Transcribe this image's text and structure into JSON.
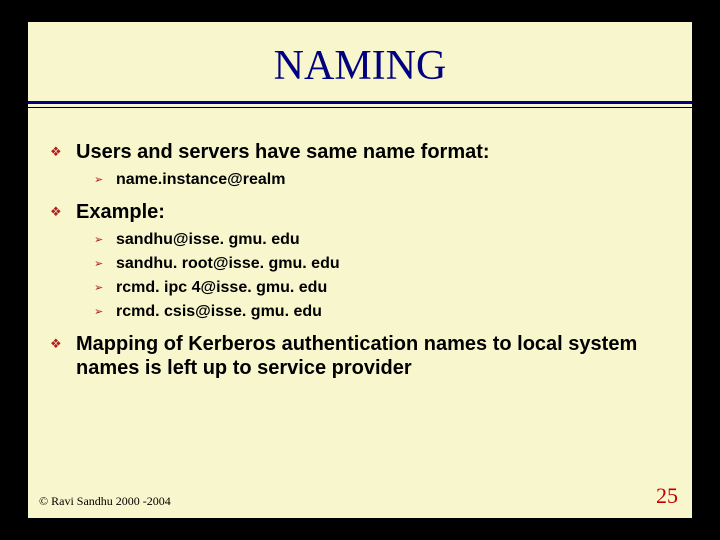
{
  "title": "NAMING",
  "bullets": [
    {
      "text": "Users and servers have same name format:",
      "sub": [
        "name.instance@realm"
      ]
    },
    {
      "text": "Example:",
      "sub": [
        "sandhu@isse. gmu. edu",
        "sandhu. root@isse. gmu. edu",
        "rcmd. ipc 4@isse. gmu. edu",
        "rcmd. csis@isse. gmu. edu"
      ]
    },
    {
      "text": "Mapping of Kerberos authentication names to local system names is left up to service provider",
      "sub": []
    }
  ],
  "footer": {
    "copyright": "© Ravi Sandhu 2000 -2004",
    "page": "25"
  }
}
